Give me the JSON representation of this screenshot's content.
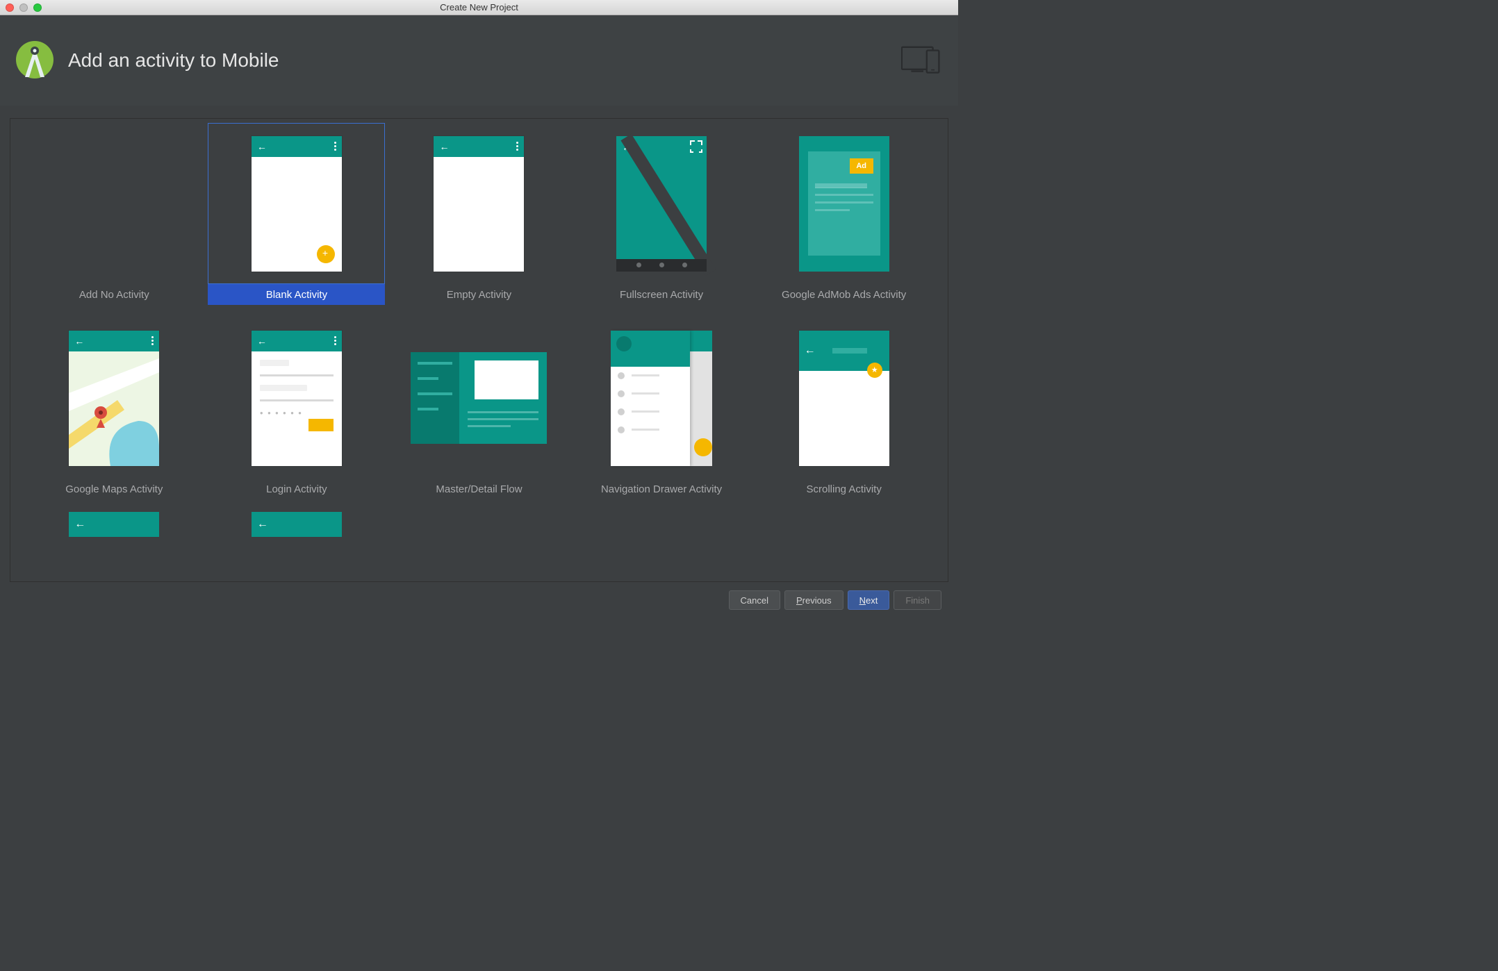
{
  "window": {
    "title": "Create New Project"
  },
  "header": {
    "title": "Add an activity to Mobile"
  },
  "templates": [
    {
      "label": "Add No Activity",
      "selected": false,
      "kind": "none"
    },
    {
      "label": "Blank Activity",
      "selected": true,
      "kind": "blank"
    },
    {
      "label": "Empty Activity",
      "selected": false,
      "kind": "empty"
    },
    {
      "label": "Fullscreen Activity",
      "selected": false,
      "kind": "fullscreen"
    },
    {
      "label": "Google AdMob Ads Activity",
      "selected": false,
      "kind": "admob",
      "ad_label": "Ad"
    },
    {
      "label": "Google Maps Activity",
      "selected": false,
      "kind": "maps"
    },
    {
      "label": "Login Activity",
      "selected": false,
      "kind": "login"
    },
    {
      "label": "Master/Detail Flow",
      "selected": false,
      "kind": "masterdetail"
    },
    {
      "label": "Navigation Drawer Activity",
      "selected": false,
      "kind": "navdrawer"
    },
    {
      "label": "Scrolling Activity",
      "selected": false,
      "kind": "scrolling"
    }
  ],
  "partial_row": [
    {
      "kind": "partial"
    },
    {
      "kind": "partial"
    }
  ],
  "footer": {
    "cancel": "Cancel",
    "previous_mnemonic": "P",
    "previous_rest": "revious",
    "next_mnemonic": "N",
    "next_rest": "ext",
    "finish": "Finish"
  }
}
